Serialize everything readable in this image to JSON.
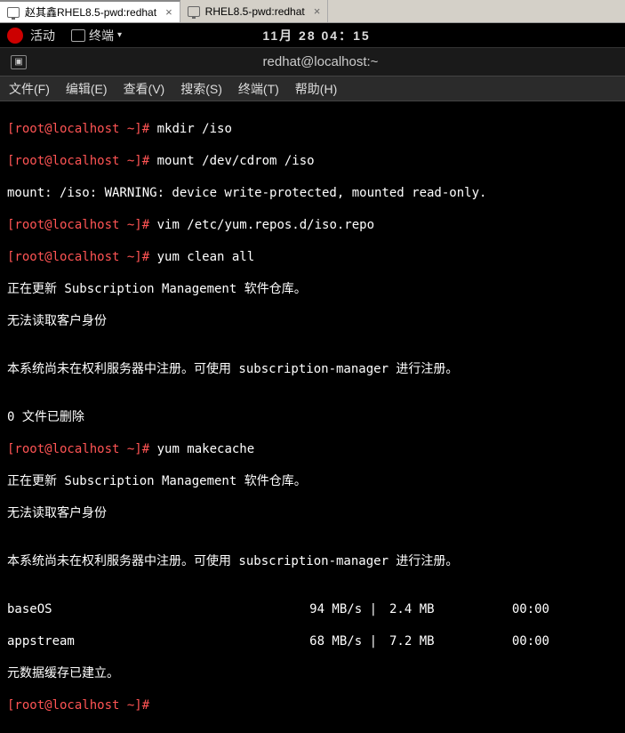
{
  "host_tabs": [
    {
      "label": "赵其鑫RHEL8.5-pwd:redhat",
      "active": true
    },
    {
      "label": "RHEL8.5-pwd:redhat",
      "active": false
    }
  ],
  "gnome": {
    "activities": "活动",
    "app": "终端",
    "clock": "11月 28 04：15"
  },
  "window": {
    "title": "redhat@localhost:~"
  },
  "menus": [
    "文件(F)",
    "编辑(E)",
    "查看(V)",
    "搜索(S)",
    "终端(T)",
    "帮助(H)"
  ],
  "p1": "[root@localhost ~]#",
  "c1": "mkdir /iso",
  "p2": "[root@localhost ~]#",
  "c2": "mount /dev/cdrom /iso",
  "l3": "mount: /iso: WARNING: device write-protected, mounted read-only.",
  "p4": "[root@localhost ~]#",
  "c4": "vim /etc/yum.repos.d/iso.repo",
  "p5": "[root@localhost ~]#",
  "c5": "yum clean all",
  "l6": "正在更新 Subscription Management 软件仓库。",
  "l7": "无法读取客户身份",
  "l8": "",
  "l9": "本系统尚未在权利服务器中注册。可使用 subscription-manager 进行注册。",
  "l10": "",
  "l11": "0 文件已删除",
  "p12": "[root@localhost ~]#",
  "c12": "yum makecache",
  "l13": "正在更新 Subscription Management 软件仓库。",
  "l14": "无法读取客户身份",
  "l15": "",
  "l16": "本系统尚未在权利服务器中注册。可使用 subscription-manager 进行注册。",
  "l17": "",
  "repo1": {
    "name": "baseOS",
    "rate": "94 MB/s |",
    "size": "2.4 MB",
    "time": "00:00"
  },
  "repo2": {
    "name": "appstream",
    "rate": "68 MB/s |",
    "size": "7.2 MB",
    "time": "00:00"
  },
  "l20": "元数据缓存已建立。",
  "p21": "[root@localhost ~]#",
  "c21": ""
}
